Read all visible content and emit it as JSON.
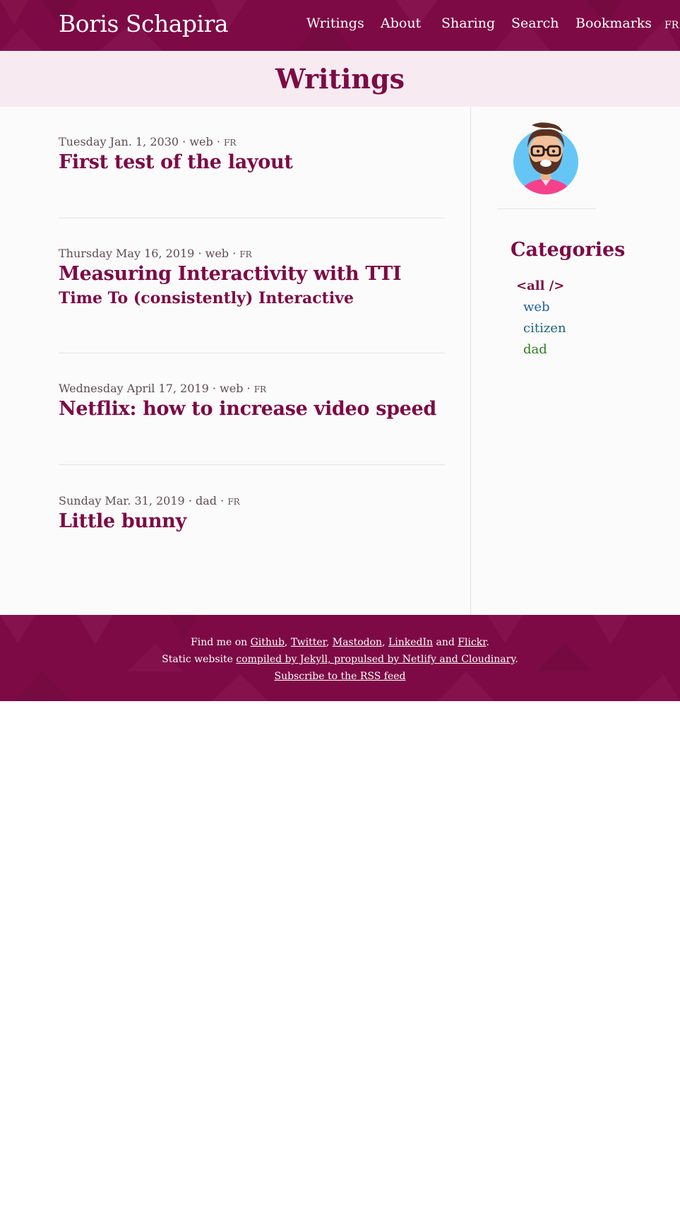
{
  "header": {
    "site_title": "Boris Schapira",
    "nav": {
      "writings": "Writings",
      "about": "About",
      "sharing": "Sharing",
      "search": "Search",
      "bookmarks": "Bookmarks",
      "lang": "FR"
    }
  },
  "page": {
    "title": "Writings"
  },
  "posts": [
    {
      "date": "Tuesday Jan. 1, 2030",
      "category": "web",
      "lang": "FR",
      "title": "First test of the layout",
      "subtitle": ""
    },
    {
      "date": "Thursday May 16, 2019",
      "category": "web",
      "lang": "FR",
      "title": "Measuring Interactivity with TTI",
      "subtitle": "Time To (consistently) Interactive"
    },
    {
      "date": "Wednesday April 17, 2019",
      "category": "web",
      "lang": "FR",
      "title": "Netflix: how to increase video speed",
      "subtitle": ""
    },
    {
      "date": "Sunday Mar. 31, 2019",
      "category": "dad",
      "lang": "FR",
      "title": "Little bunny",
      "subtitle": ""
    }
  ],
  "separator": "·",
  "sidebar": {
    "avatar_icon": "bearded-man-avatar",
    "categories_heading": "Categories",
    "categories": {
      "all": "<all />",
      "web": "web",
      "citizen": "citizen",
      "dad": "dad"
    }
  },
  "footer": {
    "find_me": "Find me on",
    "github": "Github",
    "twitter": "Twitter",
    "mastodon": "Mastodon",
    "linkedin": "LinkedIn",
    "and": "and",
    "flickr": "Flickr",
    "static_prefix": "Static website",
    "static_link": "compiled by Jekyll, propulsed by Netlify and Cloudinary",
    "rss": "Subscribe to the RSS feed"
  },
  "colors": {
    "brand": "#7d0a45",
    "title_band": "#f7ebf1",
    "cat_web": "#1a5fa5",
    "cat_citizen": "#1b6776",
    "cat_dad": "#2b7e1a"
  }
}
